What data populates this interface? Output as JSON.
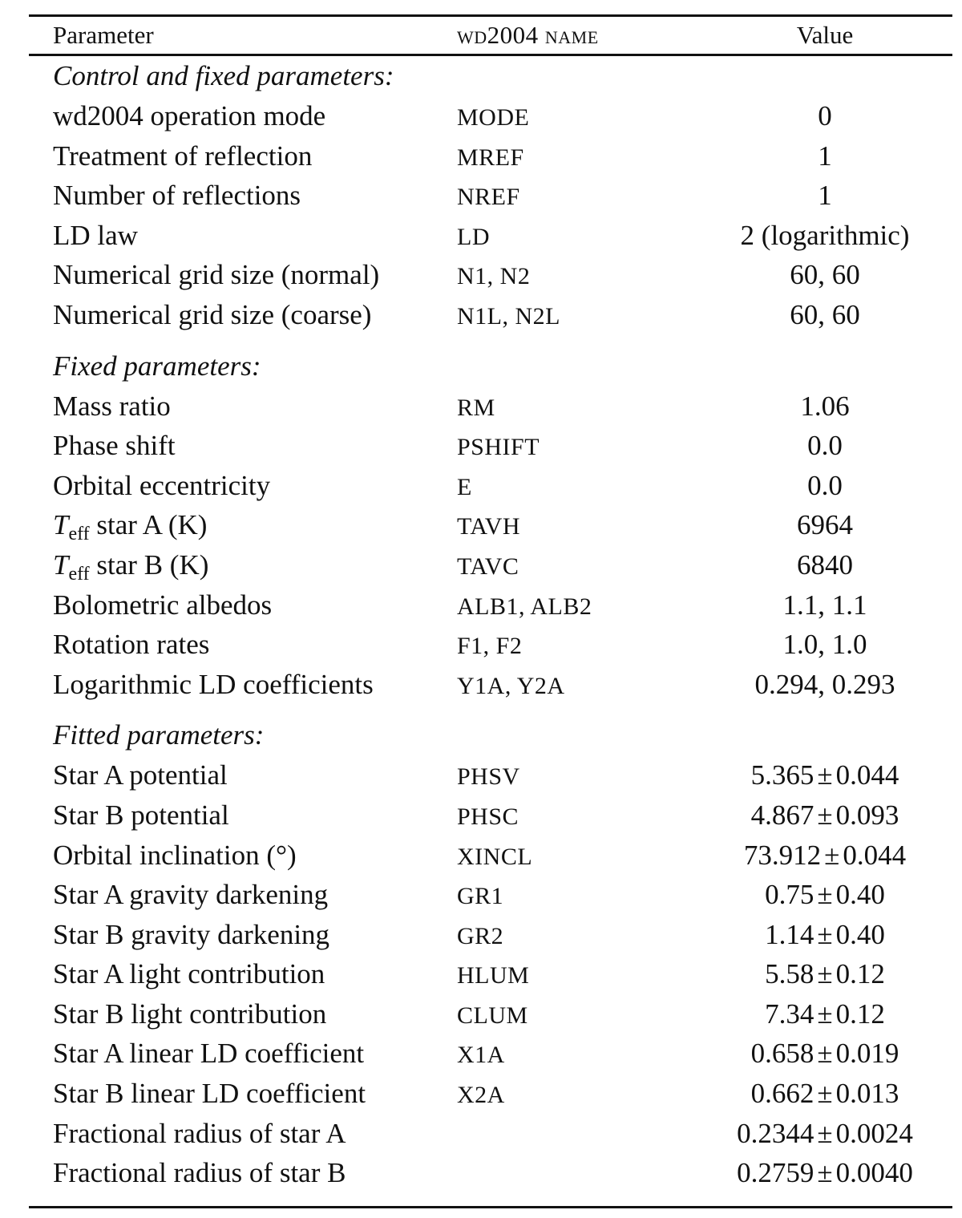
{
  "header": {
    "parameter": "Parameter",
    "wd_name": "wd2004 name",
    "value": "Value"
  },
  "sections": [
    {
      "title": "Control and fixed parameters:",
      "rows": [
        {
          "parameter": "wd2004 operation mode",
          "wd_name": "MODE",
          "value": "0"
        },
        {
          "parameter": "Treatment of reflection",
          "wd_name": "MREF",
          "value": "1"
        },
        {
          "parameter": "Number of reflections",
          "wd_name": "NREF",
          "value": "1"
        },
        {
          "parameter": "LD law",
          "wd_name": "LD",
          "value": "2 (logarithmic)"
        },
        {
          "parameter": "Numerical grid size (normal)",
          "wd_name": "N1, N2",
          "value": "60, 60"
        },
        {
          "parameter": "Numerical grid size (coarse)",
          "wd_name": "N1L, N2L",
          "value": "60, 60"
        }
      ]
    },
    {
      "title": "Fixed parameters:",
      "rows": [
        {
          "parameter": "Mass ratio",
          "wd_name": "RM",
          "value": "1.06"
        },
        {
          "parameter": "Phase shift",
          "wd_name": "PSHIFT",
          "value": "0.0"
        },
        {
          "parameter": "Orbital eccentricity",
          "wd_name": "E",
          "value": "0.0"
        },
        {
          "parameter_symbol": "T",
          "parameter_sub": "eff",
          "parameter": " star A (K)",
          "wd_name": "TAVH",
          "value": "6964"
        },
        {
          "parameter_symbol": "T",
          "parameter_sub": "eff",
          "parameter": " star B (K)",
          "wd_name": "TAVC",
          "value": "6840"
        },
        {
          "parameter": "Bolometric albedos",
          "wd_name": "ALB1, ALB2",
          "value": "1.1, 1.1"
        },
        {
          "parameter": "Rotation rates",
          "wd_name": "F1, F2",
          "value": "1.0, 1.0"
        },
        {
          "parameter": "Logarithmic LD coefficients",
          "wd_name": "Y1A, Y2A",
          "value": "0.294, 0.293"
        }
      ]
    },
    {
      "title": "Fitted parameters:",
      "rows": [
        {
          "parameter": "Star A potential",
          "wd_name": "PHSV",
          "value": "5.365",
          "error": "0.044"
        },
        {
          "parameter": "Star B potential",
          "wd_name": "PHSC",
          "value": "4.867",
          "error": "0.093"
        },
        {
          "parameter": "Orbital inclination (°)",
          "wd_name": "XINCL",
          "value": "73.912",
          "error": "0.044"
        },
        {
          "parameter": "Star A gravity darkening",
          "wd_name": "GR1",
          "value": "0.75",
          "error": "0.40"
        },
        {
          "parameter": "Star B gravity darkening",
          "wd_name": "GR2",
          "value": "1.14",
          "error": "0.40"
        },
        {
          "parameter": "Star A light contribution",
          "wd_name": "HLUM",
          "value": "5.58",
          "error": "0.12"
        },
        {
          "parameter": "Star B light contribution",
          "wd_name": "CLUM",
          "value": "7.34",
          "error": "0.12"
        },
        {
          "parameter": "Star A linear LD coefficient",
          "wd_name": "X1A",
          "value": "0.658",
          "error": "0.019"
        },
        {
          "parameter": "Star B linear LD coefficient",
          "wd_name": "X2A",
          "value": "0.662",
          "error": "0.013"
        },
        {
          "parameter": "Fractional radius of star A",
          "wd_name": "",
          "value": "0.2344",
          "error": "0.0024"
        },
        {
          "parameter": "Fractional radius of star B",
          "wd_name": "",
          "value": "0.2759",
          "error": "0.0040"
        }
      ]
    }
  ],
  "pm_symbol": "±"
}
